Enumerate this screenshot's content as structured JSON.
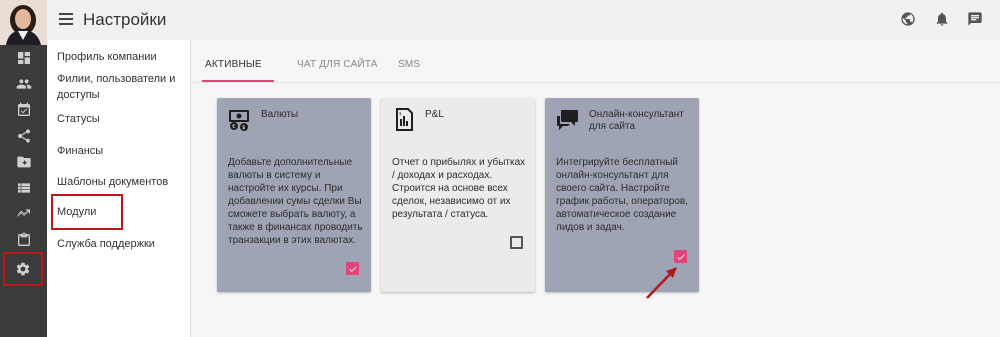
{
  "header": {
    "title": "Настройки",
    "icons": [
      "globe-icon",
      "bell-icon",
      "chat-icon"
    ]
  },
  "rail": {
    "icons": [
      "dashboard-icon",
      "people-icon",
      "calendar-check-icon",
      "share-icon",
      "folder-icon",
      "list-icon",
      "trend-icon",
      "clipboard-icon",
      "gear-icon"
    ],
    "active_index": 8,
    "highlight_color": "#c0161b"
  },
  "sidemenu": {
    "items": [
      {
        "label": "Профиль компании"
      },
      {
        "label": "Филии, пользователи и доступы"
      },
      {
        "label": "Статусы"
      },
      {
        "label": "Финансы"
      },
      {
        "label": "Шаблоны документов"
      },
      {
        "label": "Модули"
      },
      {
        "label": "Служба поддержки"
      }
    ]
  },
  "tabs": [
    {
      "label": "АКТИВНЫЕ"
    },
    {
      "label": "ЧАТ ДЛЯ САЙТА"
    },
    {
      "label": "SMS"
    }
  ],
  "accent_color": "#e0457b",
  "cards": [
    {
      "title": "Валюты",
      "icon": "currency-icon",
      "description": "Добавьте дополнительные валюты в систему и настройте их курсы. При добавлении сумы сделки Вы сможете выбрать валюту, а также в финансах проводить транзакции в этих валютах.",
      "checked": true
    },
    {
      "title": "P&L",
      "icon": "report-icon",
      "description": "Отчет о прибылях и убытках / доходах и расходах. Строится на основе всех сделок, независимо от их результата / статуса.",
      "checked": false
    },
    {
      "title": "Онлайн-консультант для сайта",
      "icon": "chat-bubbles-icon",
      "description": "Интегрируйте бесплатный онлайн-консультант для своего сайта. Настройте график работы, операторов, автоматическое создание лидов и задач.",
      "checked": true
    }
  ]
}
